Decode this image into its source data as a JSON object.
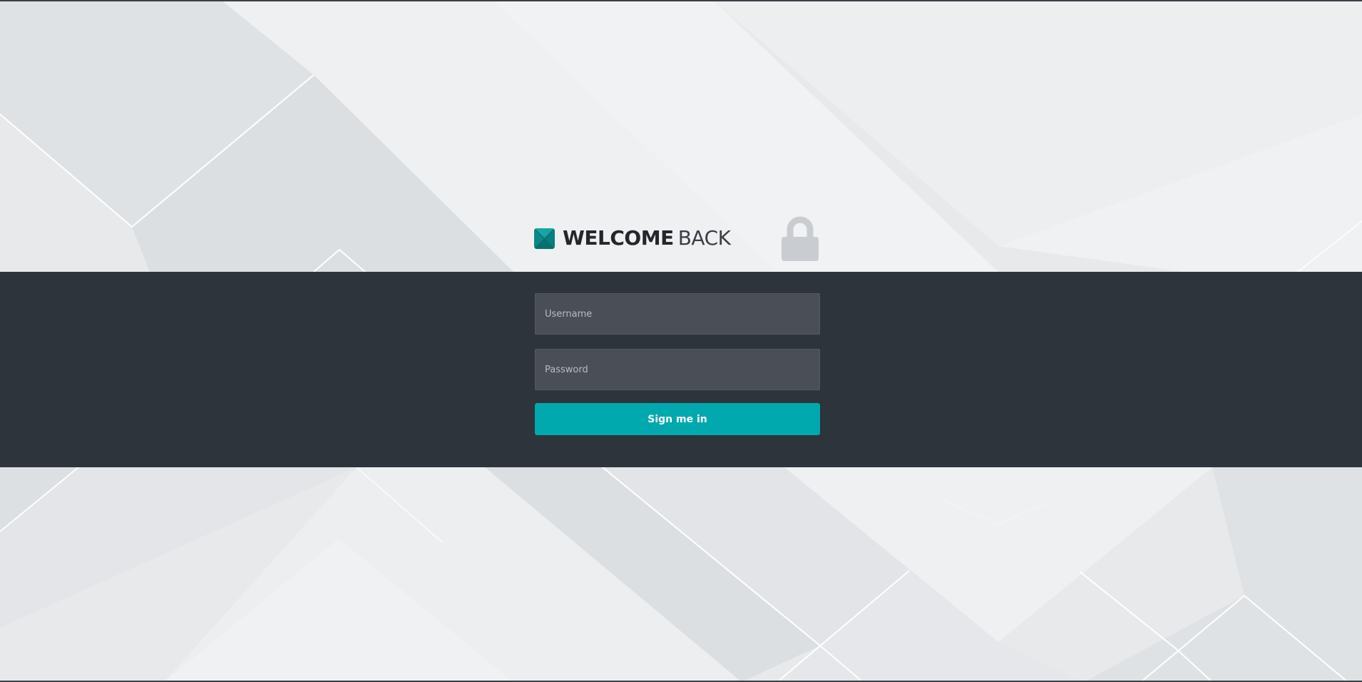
{
  "header": {
    "title_bold": "WELCOME",
    "title_light": "BACK",
    "logo_icon": "teal-square-logo-icon",
    "lock_icon": "padlock-icon"
  },
  "login_form": {
    "username_placeholder": "Username",
    "password_placeholder": "Password",
    "submit_label": "Sign me in"
  },
  "colors": {
    "accent": "#00a9ad",
    "band": "#2d343c",
    "field": "#4a4f57",
    "background": "#e6e8ea"
  }
}
